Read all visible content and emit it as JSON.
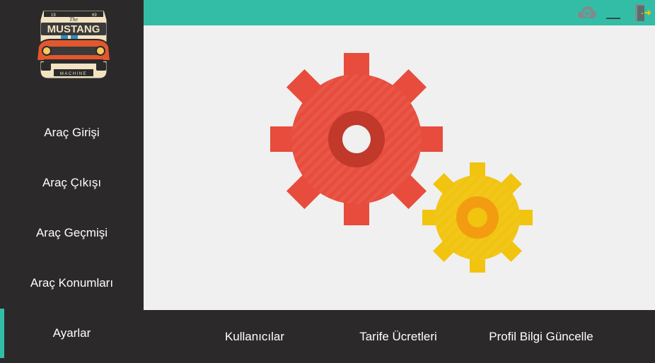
{
  "brand": {
    "logo_year_left": "19",
    "logo_year_right": "69",
    "logo_small": "The",
    "logo_title": "MUSTANG",
    "logo_tagline": "MACHINE"
  },
  "sidebar": {
    "items": [
      {
        "label": "Araç Girişi"
      },
      {
        "label": "Araç Çıkışı"
      },
      {
        "label": "Araç Geçmişi"
      },
      {
        "label": "Araç Konumları"
      },
      {
        "label": "Ayarlar",
        "active": true
      }
    ]
  },
  "topbar": {
    "icons": [
      "cloud-power-icon",
      "minimize-icon",
      "exit-door-icon"
    ],
    "minimize_label": "__"
  },
  "settings_tabs": [
    {
      "label": "Kullanıcılar"
    },
    {
      "label": "Tarife Ücretleri"
    },
    {
      "label": "Profil Bilgi Güncelle"
    }
  ],
  "colors": {
    "accent": "#34bda6",
    "sidebar_bg": "#2b292a",
    "content_bg": "#f0f0f0",
    "gear_red": "#e74c3c",
    "gear_red_dark": "#c0392b",
    "gear_yellow": "#f1c40f",
    "gear_orange": "#f39c12"
  }
}
